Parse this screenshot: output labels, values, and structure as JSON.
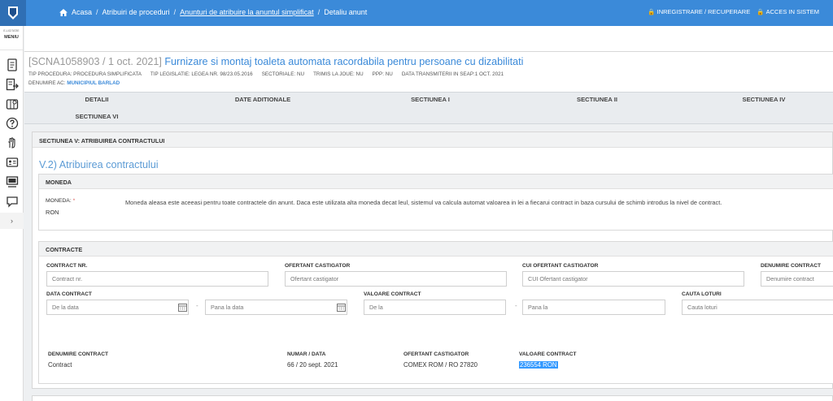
{
  "topbar": {
    "breadcrumbs": {
      "home": "Acasa",
      "item2": "Atribuiri de proceduri",
      "item3": "Anunturi de atribuire la anuntul simplificat",
      "item4": "Detaliu anunt"
    },
    "register": "INREGISTRARE / RECUPERARE",
    "access": "ACCES IN SISTEM",
    "bar_color": "#3b8ad9"
  },
  "sidebar": {
    "small_label": "E-LICITATIE",
    "menu_label": "MENIU",
    "icons": [
      "document-icon",
      "export-icon",
      "map-icon",
      "help-icon",
      "hand-icon",
      "contact-card-icon",
      "presentation-icon",
      "chat-icon"
    ],
    "expand": "›"
  },
  "header": {
    "code": "[SCNA1058903 / 1 oct. 2021]",
    "title": "Furnizare si montaj toaleta automata racordabila pentru persoane cu dizabilitati",
    "meta": [
      "TIP PROCEDURA: PROCEDURA SIMPLIFICATA",
      "TIP LEGISLATIE: LEGEA NR. 98/23.05.2016",
      "SECTORIALE: NU",
      "TRIMIS LA JOUE: NU",
      "PPP: NU",
      "DATA TRANSMITERII IN SEAP:1 OCT. 2021"
    ],
    "ac_label": "DENUMIRE AC:",
    "ac_value": "MUNICIPIUL BARLAD"
  },
  "tabs": [
    "DETALII",
    "DATE ADITIONALE",
    "SECTIUNEA I",
    "SECTIUNEA II",
    "SECTIUNEA IV",
    "SECTIUNEA VI"
  ],
  "section": {
    "heading": "SECTIUNEA V: ATRIBUIREA CONTRACTULUI",
    "subtitle": "V.2) Atribuirea contractului",
    "moneda": {
      "heading": "MONEDA",
      "label": "MONEDA:",
      "required": "*",
      "value": "RON",
      "description": "Moneda aleasa este aceeasi pentru toate contractele din anunt. Daca este utilizata alta moneda decat leul, sistemul va calcula automat valoarea in lei a fiecarui contract in baza cursului de schimb introdus la nivel de contract."
    },
    "contracte": {
      "heading": "CONTRACTE",
      "filters": {
        "contract_nr_label": "CONTRACT NR.",
        "contract_nr_placeholder": "Contract nr.",
        "ofertant_label": "OFERTANT CASTIGATOR",
        "ofertant_placeholder": "Ofertant castigator",
        "cui_label": "CUI OFERTANT CASTIGATOR",
        "cui_placeholder": "CUI Ofertant castigator",
        "denumire_label": "DENUMIRE CONTRACT",
        "denumire_placeholder": "Denumire contract",
        "data_label": "DATA CONTRACT",
        "data_from_placeholder": "De la data",
        "data_to_placeholder": "Pana la data",
        "valoare_label": "VALOARE CONTRACT",
        "valoare_from_placeholder": "De la",
        "valoare_to_placeholder": "Pana la",
        "loturi_label": "CAUTA LOTURI",
        "loturi_placeholder": "Cauta loturi",
        "range_sep": "-"
      },
      "result": {
        "headers": [
          "DENUMIRE CONTRACT",
          "NUMAR / DATA",
          "OFERTANT CASTIGATOR",
          "VALOARE CONTRACT"
        ],
        "row": [
          "Contract",
          "66 / 20 sept. 2021",
          "COMEX ROM / RO 27820",
          "236554 RON"
        ]
      }
    }
  },
  "colors": {
    "accent": "#3b8ad9",
    "subtitle": "#5b9bd5",
    "selection": "#3399ff"
  }
}
